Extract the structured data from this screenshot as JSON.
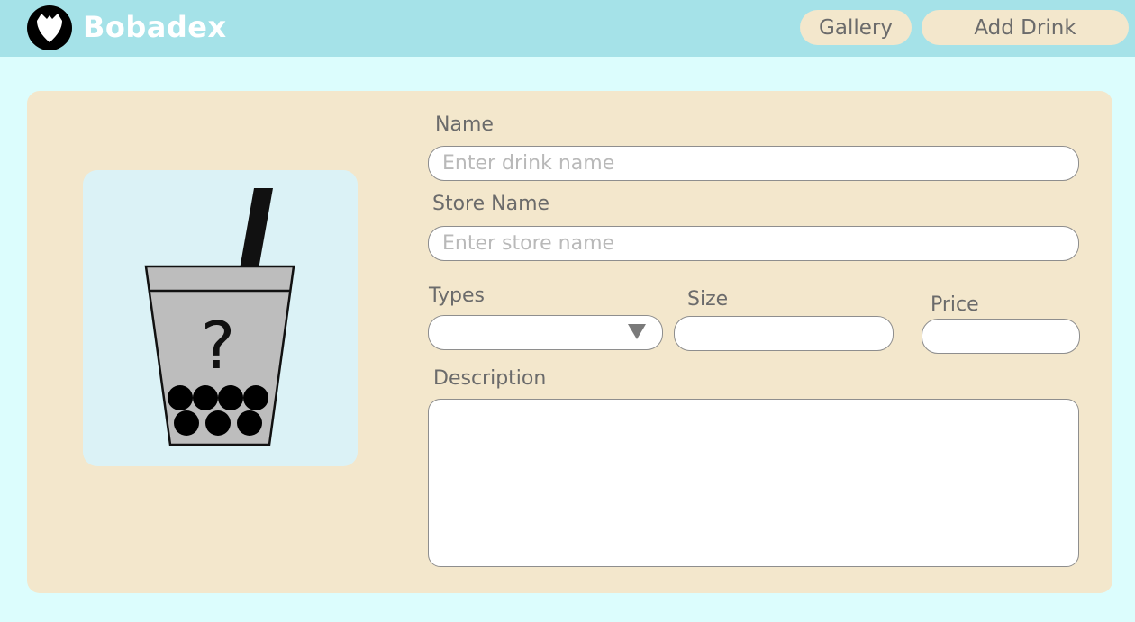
{
  "app": {
    "title": "Bobadex"
  },
  "nav": {
    "gallery": "Gallery",
    "add_drink": "Add Drink"
  },
  "form": {
    "name_label": "Name",
    "name_placeholder": "Enter drink name",
    "store_label": "Store Name",
    "store_placeholder": "Enter store name",
    "types_label": "Types",
    "size_label": "Size",
    "price_label": "Price",
    "description_label": "Description"
  },
  "image": {
    "icon": "boba-cup-question-icon",
    "glyph": "?"
  },
  "colors": {
    "header": "#a5e2e8",
    "page": "#dcfdfd",
    "card": "#f3e7cc",
    "image_bg": "#dbf2f6"
  }
}
